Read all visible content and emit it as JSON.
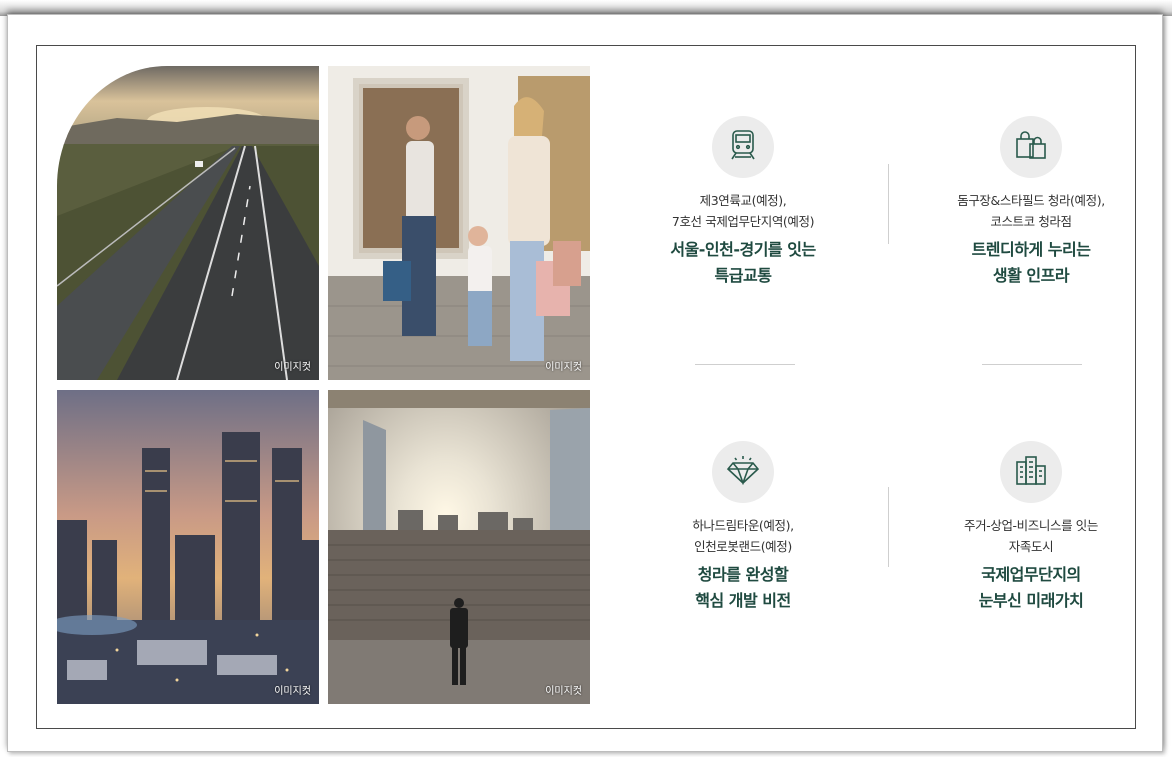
{
  "photos": [
    {
      "name": "highway-photo",
      "caption": "이미지컷"
    },
    {
      "name": "shopping-family-photo",
      "caption": "이미지컷"
    },
    {
      "name": "city-skyline-photo",
      "caption": "이미지컷"
    },
    {
      "name": "sunrise-business-photo",
      "caption": "이미지컷"
    }
  ],
  "features": [
    {
      "icon": "train-icon",
      "sub1": "제3연륙교(예정),",
      "sub2": "7호선 국제업무단지역(예정)",
      "main1": "서울-인천-경기를 잇는",
      "main2": "특급교통"
    },
    {
      "icon": "shopping-bags-icon",
      "sub1": "돔구장&스타필드 청라(예정),",
      "sub2": "코스트코 청라점",
      "main1": "트렌디하게 누리는",
      "main2": "생활 인프라"
    },
    {
      "icon": "diamond-icon",
      "sub1": "하나드림타운(예정),",
      "sub2": "인천로봇랜드(예정)",
      "main1": "청라를 완성할",
      "main2": "핵심 개발 비전"
    },
    {
      "icon": "buildings-icon",
      "sub1": "주거-상업-비즈니스를 잇는",
      "sub2": "자족도시",
      "main1": "국제업무단지의",
      "main2": "눈부신 미래가치"
    }
  ],
  "colors": {
    "accent": "#1f4a40",
    "icon_bg": "#ececec"
  }
}
